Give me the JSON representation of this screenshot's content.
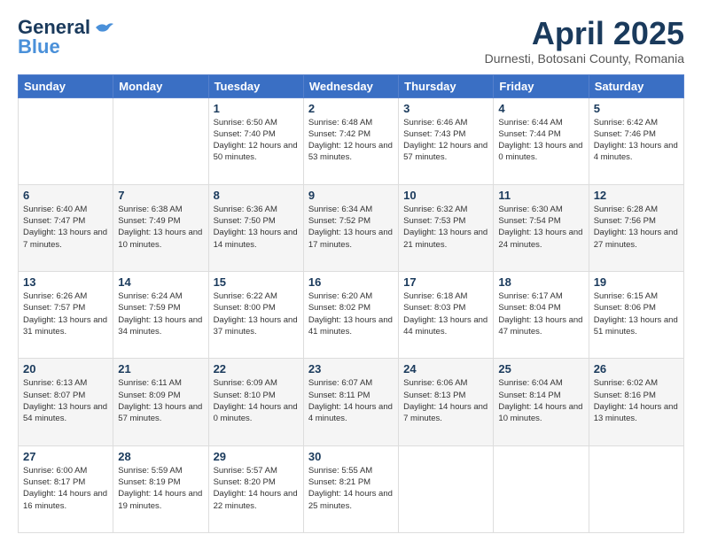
{
  "header": {
    "logo_general": "General",
    "logo_blue": "Blue",
    "main_title": "April 2025",
    "subtitle": "Durnesti, Botosani County, Romania"
  },
  "days_of_week": [
    "Sunday",
    "Monday",
    "Tuesday",
    "Wednesday",
    "Thursday",
    "Friday",
    "Saturday"
  ],
  "weeks": [
    [
      {
        "day": "",
        "info": ""
      },
      {
        "day": "",
        "info": ""
      },
      {
        "day": "1",
        "info": "Sunrise: 6:50 AM\nSunset: 7:40 PM\nDaylight: 12 hours and 50 minutes."
      },
      {
        "day": "2",
        "info": "Sunrise: 6:48 AM\nSunset: 7:42 PM\nDaylight: 12 hours and 53 minutes."
      },
      {
        "day": "3",
        "info": "Sunrise: 6:46 AM\nSunset: 7:43 PM\nDaylight: 12 hours and 57 minutes."
      },
      {
        "day": "4",
        "info": "Sunrise: 6:44 AM\nSunset: 7:44 PM\nDaylight: 13 hours and 0 minutes."
      },
      {
        "day": "5",
        "info": "Sunrise: 6:42 AM\nSunset: 7:46 PM\nDaylight: 13 hours and 4 minutes."
      }
    ],
    [
      {
        "day": "6",
        "info": "Sunrise: 6:40 AM\nSunset: 7:47 PM\nDaylight: 13 hours and 7 minutes."
      },
      {
        "day": "7",
        "info": "Sunrise: 6:38 AM\nSunset: 7:49 PM\nDaylight: 13 hours and 10 minutes."
      },
      {
        "day": "8",
        "info": "Sunrise: 6:36 AM\nSunset: 7:50 PM\nDaylight: 13 hours and 14 minutes."
      },
      {
        "day": "9",
        "info": "Sunrise: 6:34 AM\nSunset: 7:52 PM\nDaylight: 13 hours and 17 minutes."
      },
      {
        "day": "10",
        "info": "Sunrise: 6:32 AM\nSunset: 7:53 PM\nDaylight: 13 hours and 21 minutes."
      },
      {
        "day": "11",
        "info": "Sunrise: 6:30 AM\nSunset: 7:54 PM\nDaylight: 13 hours and 24 minutes."
      },
      {
        "day": "12",
        "info": "Sunrise: 6:28 AM\nSunset: 7:56 PM\nDaylight: 13 hours and 27 minutes."
      }
    ],
    [
      {
        "day": "13",
        "info": "Sunrise: 6:26 AM\nSunset: 7:57 PM\nDaylight: 13 hours and 31 minutes."
      },
      {
        "day": "14",
        "info": "Sunrise: 6:24 AM\nSunset: 7:59 PM\nDaylight: 13 hours and 34 minutes."
      },
      {
        "day": "15",
        "info": "Sunrise: 6:22 AM\nSunset: 8:00 PM\nDaylight: 13 hours and 37 minutes."
      },
      {
        "day": "16",
        "info": "Sunrise: 6:20 AM\nSunset: 8:02 PM\nDaylight: 13 hours and 41 minutes."
      },
      {
        "day": "17",
        "info": "Sunrise: 6:18 AM\nSunset: 8:03 PM\nDaylight: 13 hours and 44 minutes."
      },
      {
        "day": "18",
        "info": "Sunrise: 6:17 AM\nSunset: 8:04 PM\nDaylight: 13 hours and 47 minutes."
      },
      {
        "day": "19",
        "info": "Sunrise: 6:15 AM\nSunset: 8:06 PM\nDaylight: 13 hours and 51 minutes."
      }
    ],
    [
      {
        "day": "20",
        "info": "Sunrise: 6:13 AM\nSunset: 8:07 PM\nDaylight: 13 hours and 54 minutes."
      },
      {
        "day": "21",
        "info": "Sunrise: 6:11 AM\nSunset: 8:09 PM\nDaylight: 13 hours and 57 minutes."
      },
      {
        "day": "22",
        "info": "Sunrise: 6:09 AM\nSunset: 8:10 PM\nDaylight: 14 hours and 0 minutes."
      },
      {
        "day": "23",
        "info": "Sunrise: 6:07 AM\nSunset: 8:11 PM\nDaylight: 14 hours and 4 minutes."
      },
      {
        "day": "24",
        "info": "Sunrise: 6:06 AM\nSunset: 8:13 PM\nDaylight: 14 hours and 7 minutes."
      },
      {
        "day": "25",
        "info": "Sunrise: 6:04 AM\nSunset: 8:14 PM\nDaylight: 14 hours and 10 minutes."
      },
      {
        "day": "26",
        "info": "Sunrise: 6:02 AM\nSunset: 8:16 PM\nDaylight: 14 hours and 13 minutes."
      }
    ],
    [
      {
        "day": "27",
        "info": "Sunrise: 6:00 AM\nSunset: 8:17 PM\nDaylight: 14 hours and 16 minutes."
      },
      {
        "day": "28",
        "info": "Sunrise: 5:59 AM\nSunset: 8:19 PM\nDaylight: 14 hours and 19 minutes."
      },
      {
        "day": "29",
        "info": "Sunrise: 5:57 AM\nSunset: 8:20 PM\nDaylight: 14 hours and 22 minutes."
      },
      {
        "day": "30",
        "info": "Sunrise: 5:55 AM\nSunset: 8:21 PM\nDaylight: 14 hours and 25 minutes."
      },
      {
        "day": "",
        "info": ""
      },
      {
        "day": "",
        "info": ""
      },
      {
        "day": "",
        "info": ""
      }
    ]
  ]
}
